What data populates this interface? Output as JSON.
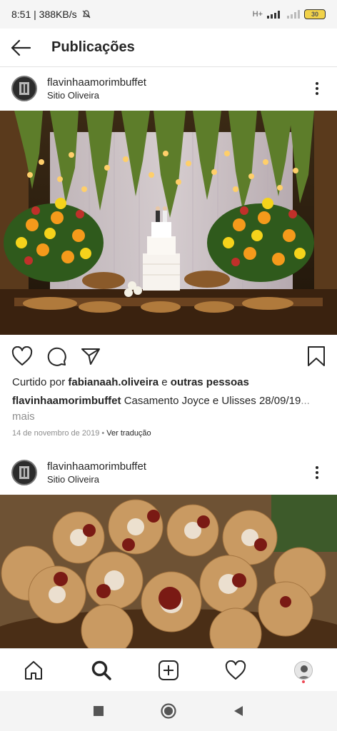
{
  "status_bar": {
    "time_speed": "8:51 | 388KB/s",
    "network": "H+",
    "battery": "30"
  },
  "header": {
    "title": "Publicações"
  },
  "posts": [
    {
      "username": "flavinhaamorimbuffet",
      "location": "Sitio Oliveira",
      "liked_by_prefix": "Curtido por ",
      "liked_by_user": "fabianaah.oliveira",
      "liked_by_joiner": " e ",
      "liked_by_others": "outras pessoas",
      "caption_user": "flavinhaamorimbuffet",
      "caption_text": " Casamento Joyce e Ulisses 28/09/19",
      "caption_more": "... mais",
      "date": "14 de novembro de 2019",
      "separator": " • ",
      "translate": "Ver tradução"
    },
    {
      "username": "flavinhaamorimbuffet",
      "location": "Sitio Oliveira"
    }
  ]
}
